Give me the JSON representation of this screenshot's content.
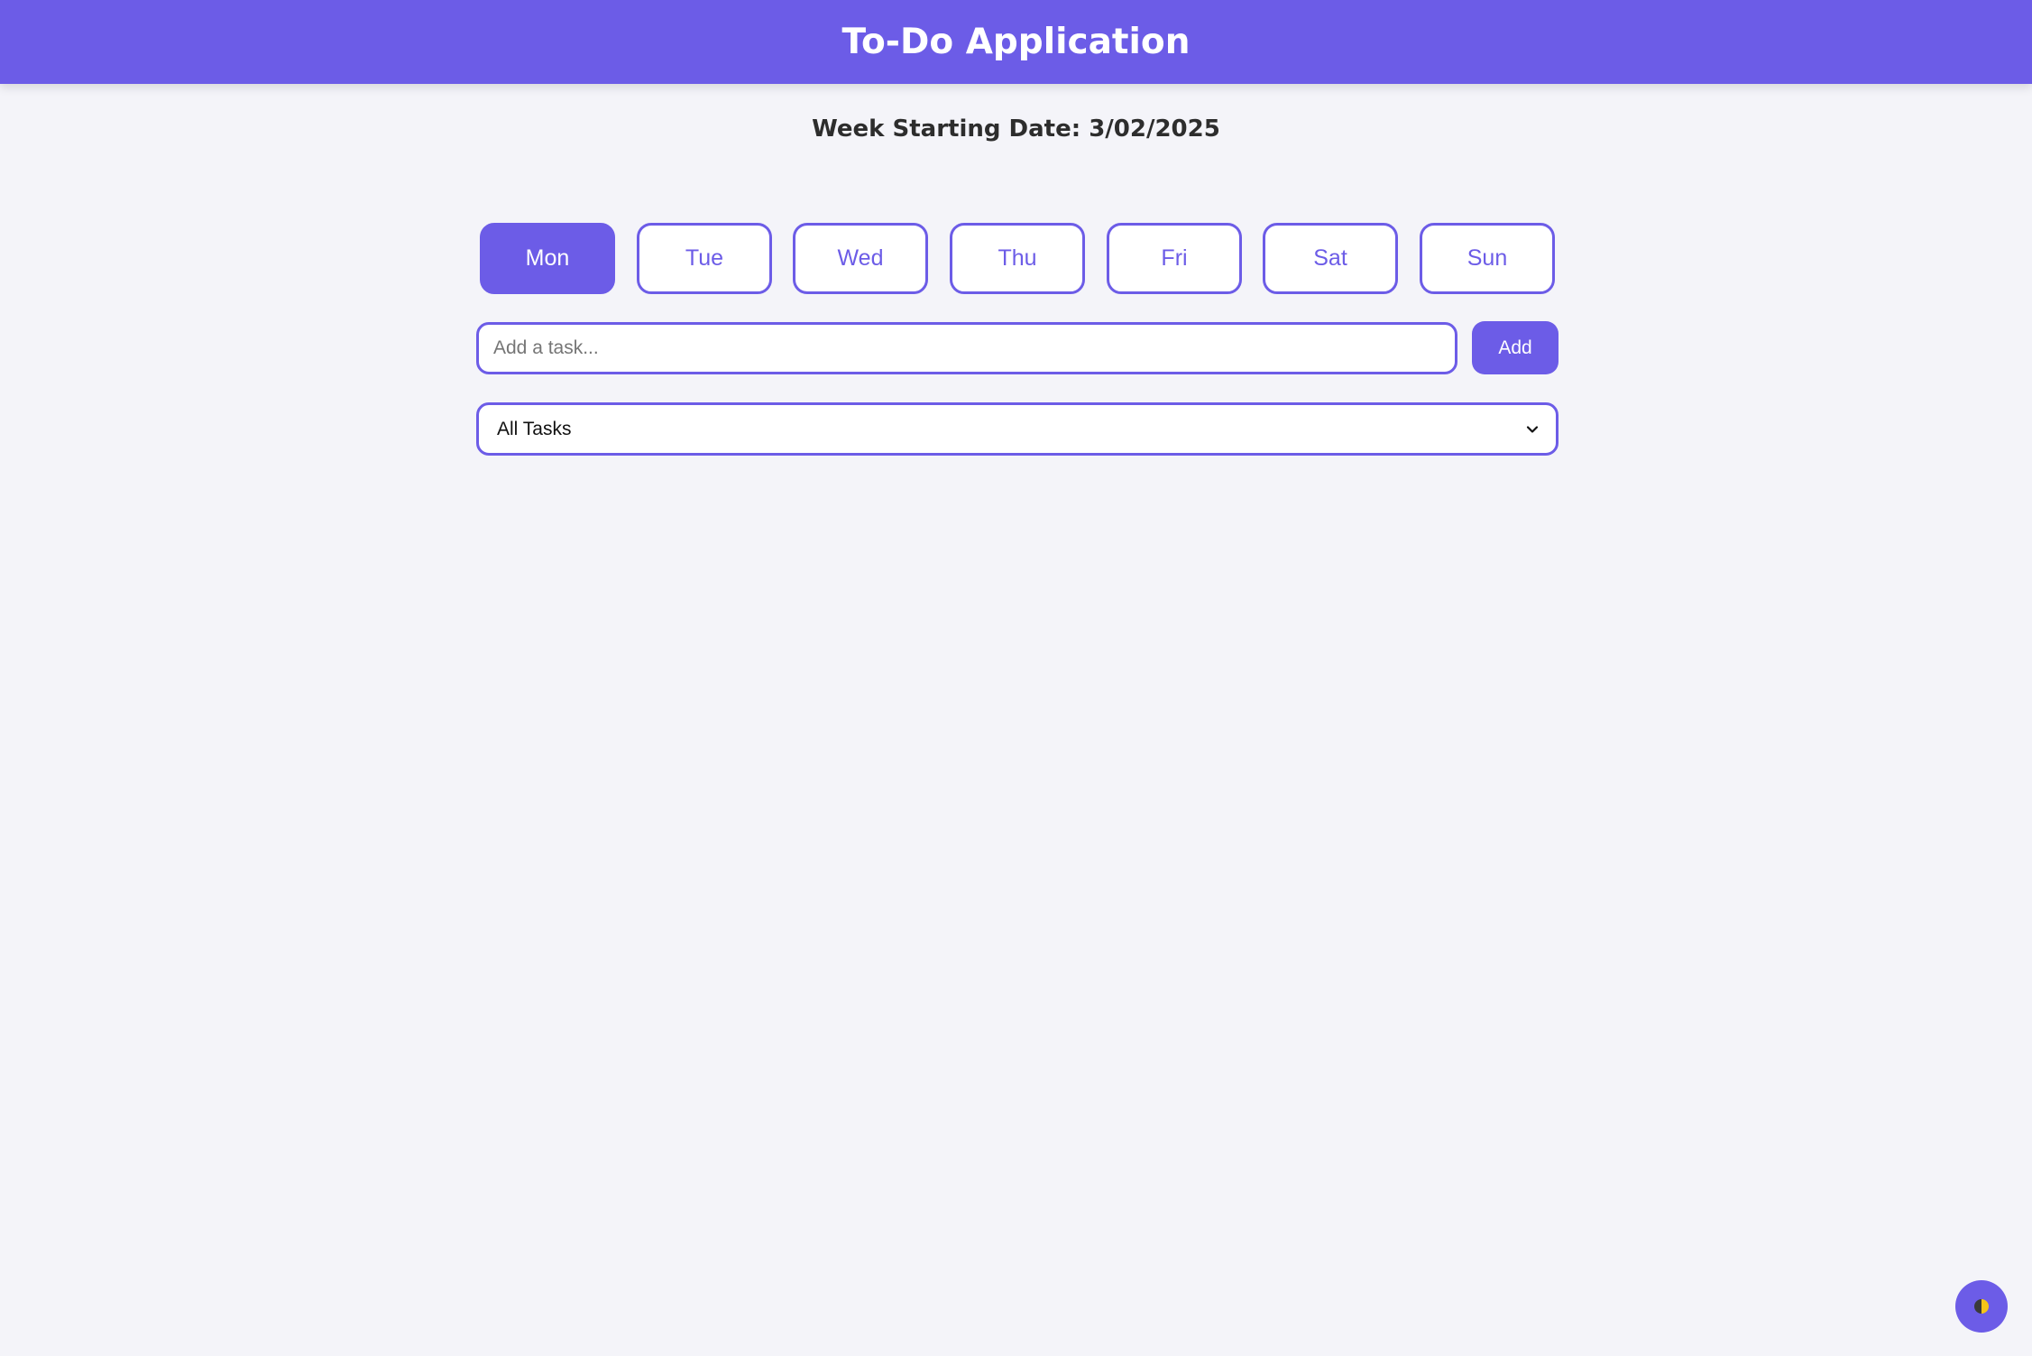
{
  "header": {
    "title": "To-Do Application"
  },
  "week": {
    "label": "Week Starting Date: 3/02/2025"
  },
  "days": [
    "Mon",
    "Tue",
    "Wed",
    "Thu",
    "Fri",
    "Sat",
    "Sun"
  ],
  "selected_day": "Mon",
  "task_input": {
    "placeholder": "Add a task...",
    "value": ""
  },
  "add_button": {
    "label": "Add"
  },
  "filter": {
    "selected": "All Tasks"
  },
  "theme_toggle": {
    "icon": "half-circle-contrast-icon"
  },
  "colors": {
    "accent": "#6c5ce7",
    "background": "#f4f4f9",
    "toggle_half": "#f5c518"
  }
}
